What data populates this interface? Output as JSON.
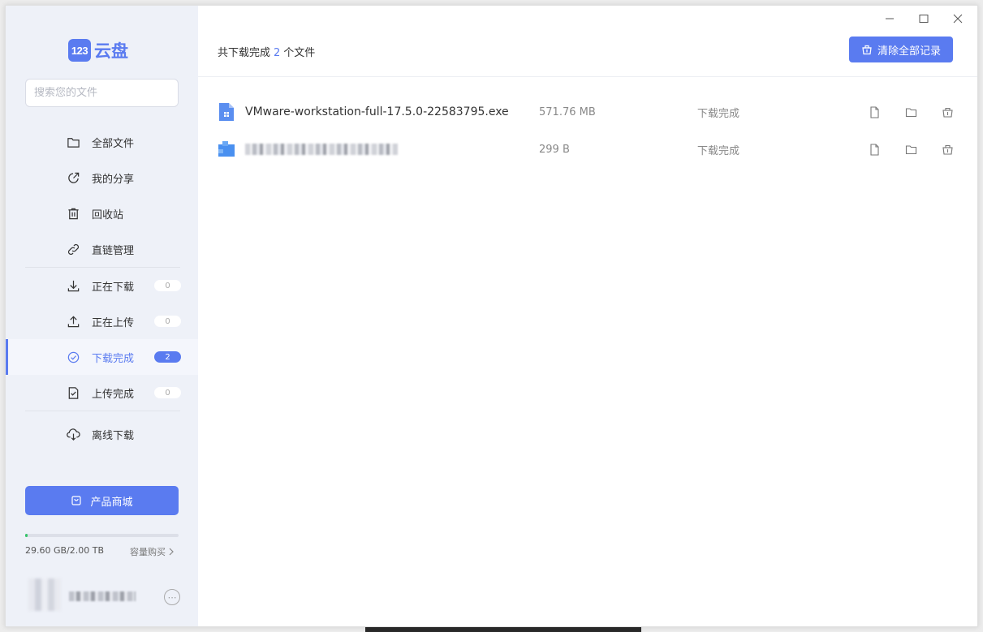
{
  "app": {
    "logo_mark": "123",
    "logo_text": "云盘",
    "brand_color": "#5a7bf0"
  },
  "search": {
    "placeholder": "搜索您的文件",
    "icon": "search-icon"
  },
  "sidebar": {
    "items": [
      {
        "label": "全部文件",
        "icon": "folder-icon"
      },
      {
        "label": "我的分享",
        "icon": "share-icon"
      },
      {
        "label": "回收站",
        "icon": "trash-icon"
      },
      {
        "label": "直链管理",
        "icon": "link-icon"
      }
    ],
    "transfer_items": [
      {
        "label": "正在下载",
        "icon": "download-icon",
        "count": "0"
      },
      {
        "label": "正在上传",
        "icon": "upload-icon",
        "count": "0"
      },
      {
        "label": "下载完成",
        "icon": "check-circle-icon",
        "count": "2",
        "active": true
      },
      {
        "label": "上传完成",
        "icon": "check-file-icon",
        "count": "0"
      }
    ],
    "offline_item": {
      "label": "离线下载",
      "icon": "cloud-download-icon"
    },
    "shop_button": "产品商城",
    "storage": {
      "used_text": "29.60 GB/2.00 TB",
      "used_fraction": 0.0145,
      "buy_label": "容量购买"
    },
    "user": {
      "more_icon": "more-icon"
    }
  },
  "window_controls": {
    "minimize": "minimize-icon",
    "maximize": "maximize-icon",
    "close": "close-icon"
  },
  "main": {
    "summary_prefix": "共下载完成",
    "summary_count": "2",
    "summary_suffix": "个文件",
    "clear_button": "清除全部记录",
    "files": [
      {
        "name": "VMware-workstation-full-17.5.0-22583795.exe",
        "size": "571.76 MB",
        "status": "下载完成",
        "icon": "exe-file-icon",
        "blurred": false
      },
      {
        "name": "",
        "size": "299 B",
        "status": "下载完成",
        "icon": "file-icon",
        "blurred": true
      }
    ],
    "row_actions": [
      "open-file-icon",
      "open-folder-icon",
      "delete-record-icon"
    ]
  }
}
